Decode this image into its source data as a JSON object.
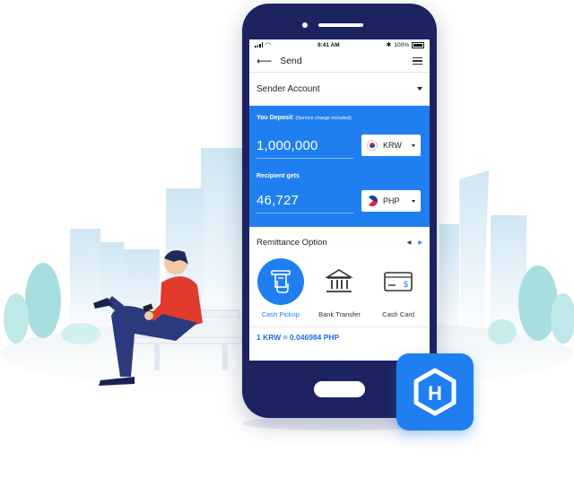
{
  "status": {
    "time": "9:41 AM",
    "battery": "100%"
  },
  "header": {
    "title": "Send"
  },
  "sender": {
    "label": "Sender Account"
  },
  "deposit": {
    "caption": "You Deposit",
    "note": "(Service charge included)",
    "amount": "1,000,000",
    "currency": "KRW"
  },
  "recipient": {
    "caption": "Recipient gets",
    "amount": "46,727",
    "currency": "PHP"
  },
  "remittance": {
    "title": "Remittance Option",
    "options": [
      {
        "label": "Cash Pickup",
        "icon": "atm-hand-icon",
        "selected": true
      },
      {
        "label": "Bank Transfer",
        "icon": "bank-icon",
        "selected": false
      },
      {
        "label": "Cash Card",
        "icon": "card-icon",
        "selected": false
      }
    ]
  },
  "rate": {
    "text": "1 KRW = 0.046984 PHP"
  },
  "brand": {
    "logo_letter": "H"
  },
  "colors": {
    "primary": "#1f7ff0",
    "phone_body": "#1c2360",
    "accent_red": "#e23b2e"
  }
}
